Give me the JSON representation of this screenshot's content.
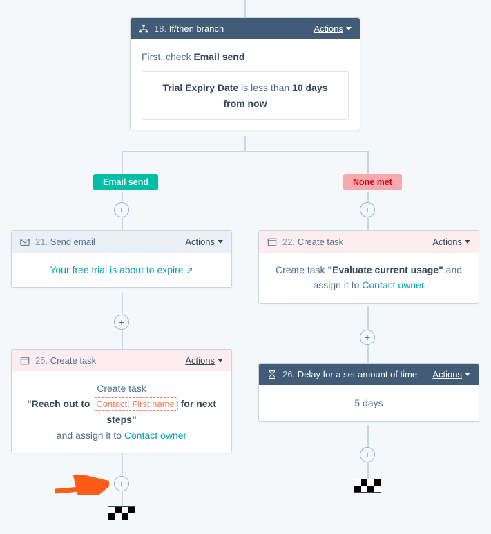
{
  "branch_card": {
    "step": "18.",
    "title": "If/then branch",
    "actions": "Actions",
    "check_prefix": "First, check ",
    "check_bold": "Email send",
    "cond_field": "Trial Expiry Date",
    "cond_mid": " is less than ",
    "cond_value": "10 days from now"
  },
  "labels": {
    "green": "Email send",
    "red": "None met"
  },
  "left1": {
    "step": "21.",
    "title": "Send email",
    "actions": "Actions",
    "link_text": "Your free trial is about to expire"
  },
  "left2": {
    "step": "25.",
    "title": "Create task",
    "actions": "Actions",
    "line1_pre": "Create task",
    "line2_pre": "\"Reach out to ",
    "token": "Contact: First name",
    "line2_post": " for next steps\"",
    "assign_pre": "and assign it to ",
    "assign_link": "Contact owner"
  },
  "right1": {
    "step": "22.",
    "title": "Create task",
    "actions": "Actions",
    "body_pre": "Create task ",
    "body_bold": "\"Evaluate current usage\"",
    "body_post": " and assign it to ",
    "body_link": "Contact owner"
  },
  "right2": {
    "step": "26.",
    "title": "Delay for a set amount of time",
    "actions": "Actions",
    "body": "5 days"
  },
  "plus": "+"
}
